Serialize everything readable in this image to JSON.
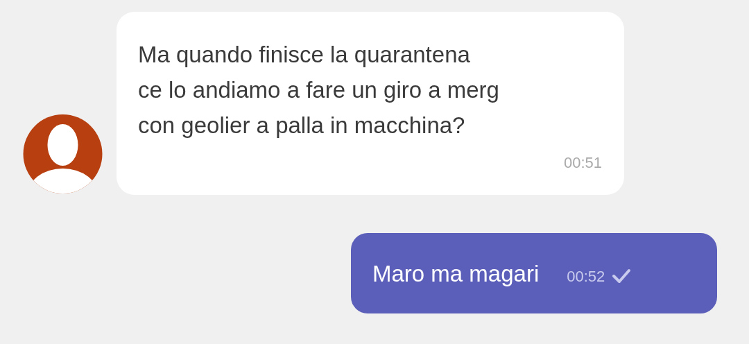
{
  "messages": [
    {
      "kind": "incoming",
      "lines": [
        "Ma quando finisce la quarantena",
        "ce lo andiamo a fare un giro a merg",
        "con geolier a palla in macchina?"
      ],
      "time": "00:51",
      "delivered": false
    },
    {
      "kind": "outgoing",
      "lines": [
        "Maro ma magari"
      ],
      "time": "00:52",
      "delivered": true
    }
  ]
}
